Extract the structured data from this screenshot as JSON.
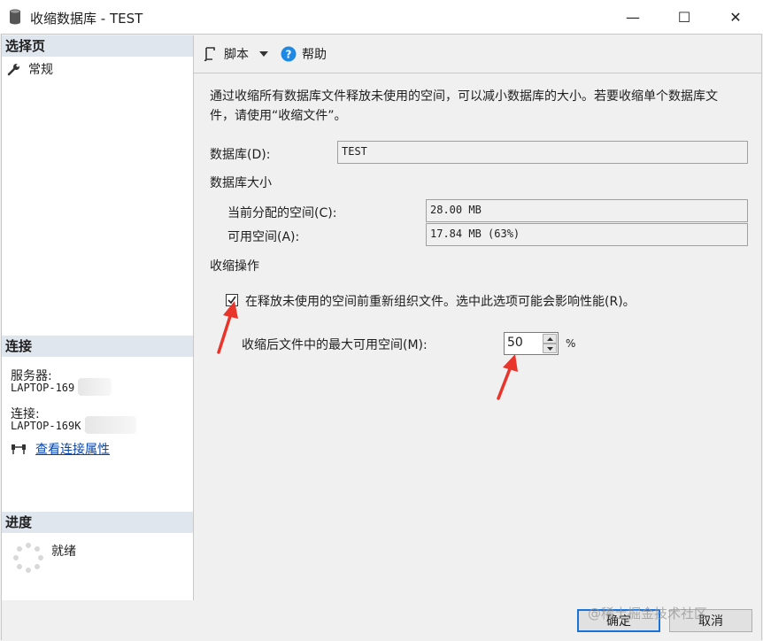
{
  "window": {
    "title": "收缩数据库 - TEST",
    "minimize_glyph": "—",
    "maximize_glyph": "☐",
    "close_glyph": "✕"
  },
  "left": {
    "select_page_header": "选择页",
    "page_general": "常规",
    "connection_header": "连接",
    "server_label": "服务器:",
    "server_value": "LAPTOP-169",
    "connection_label": "连接:",
    "connection_value": "LAPTOP-169K",
    "view_connection_link": "查看连接属性",
    "progress_header": "进度",
    "progress_status": "就绪"
  },
  "toolbar": {
    "script_label": "脚本",
    "help_label": "帮助"
  },
  "content": {
    "description": "通过收缩所有数据库文件释放未使用的空间，可以减小数据库的大小。若要收缩单个数据库文件，请使用“收缩文件”。",
    "database_label": "数据库(D):",
    "database_value": "TEST",
    "db_size_header": "数据库大小",
    "allocated_label": "当前分配的空间(C):",
    "allocated_value": "28.00 MB",
    "free_label": "可用空间(A):",
    "free_value": "17.84 MB (63%)",
    "shrink_action_header": "收缩操作",
    "reorganize_checkbox_label": "在释放未使用的空间前重新组织文件。选中此选项可能会影响性能(R)。",
    "reorganize_checked": true,
    "max_free_label": "收缩后文件中的最大可用空间(M):",
    "max_free_value": "50",
    "percent_sign": "%"
  },
  "footer": {
    "ok_label": "确定",
    "cancel_label": "取消",
    "watermark": "@稀土掘金技术社区"
  },
  "colors": {
    "section_header_bg": "#dfe6ee",
    "annotation_arrow": "#e8342a",
    "link": "#0645ad",
    "default_button_border": "#1a73d9"
  }
}
